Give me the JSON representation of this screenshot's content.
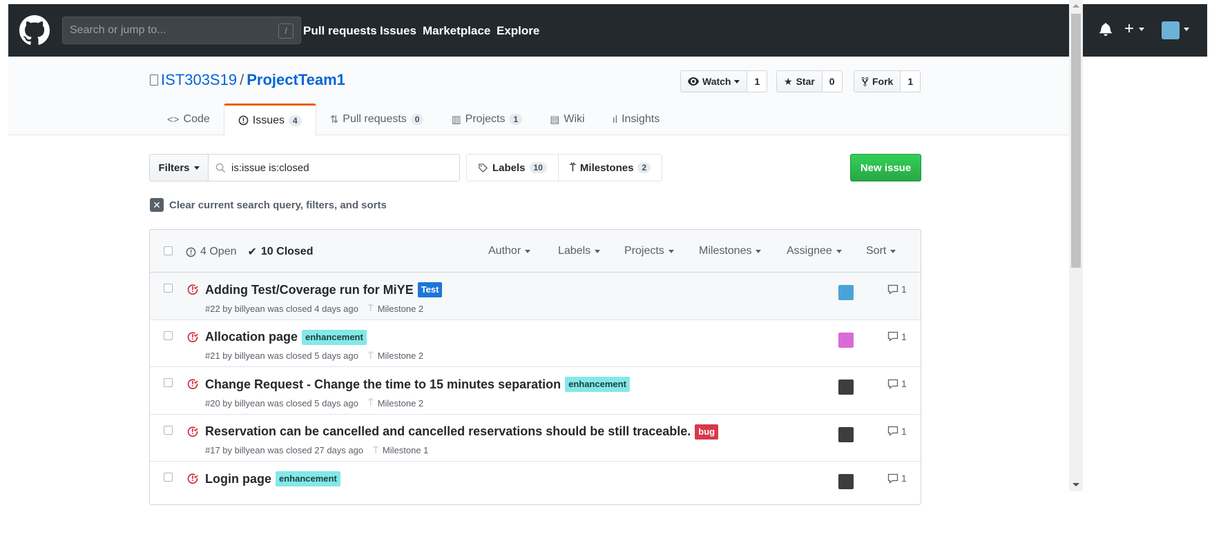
{
  "topnav": {
    "search_placeholder": "Search or jump to...",
    "slash": "/",
    "links": [
      "Pull requests",
      "Issues",
      "Marketplace",
      "Explore"
    ]
  },
  "repo": {
    "owner": "IST303S19",
    "separator": "/",
    "name": "ProjectTeam1",
    "watch_label": "Watch",
    "watch_count": "1",
    "star_label": "Star",
    "star_count": "0",
    "fork_label": "Fork",
    "fork_count": "1"
  },
  "tabs": [
    {
      "label": "Code",
      "icon": "code-icon",
      "count": ""
    },
    {
      "label": "Issues",
      "icon": "issue-opened-icon",
      "count": "4"
    },
    {
      "label": "Pull requests",
      "icon": "git-pull-request-icon",
      "count": "0"
    },
    {
      "label": "Projects",
      "icon": "project-icon",
      "count": "1"
    },
    {
      "label": "Wiki",
      "icon": "book-icon",
      "count": ""
    },
    {
      "label": "Insights",
      "icon": "graph-icon",
      "count": ""
    }
  ],
  "subnav": {
    "filters_label": "Filters",
    "search_value": "is:issue is:closed",
    "labels_label": "Labels",
    "labels_count": "10",
    "milestones_label": "Milestones",
    "milestones_count": "2",
    "new_issue_label": "New issue",
    "clear_label": "Clear current search query, filters, and sorts"
  },
  "issues_header": {
    "open_label": "4 Open",
    "closed_label": "10 Closed",
    "dropdowns": [
      "Author",
      "Labels",
      "Projects",
      "Milestones",
      "Assignee",
      "Sort"
    ]
  },
  "issues": [
    {
      "title": "Adding Test/Coverage run for MiYE",
      "label": "Test",
      "label_type": "test",
      "meta": "#22 by billyean was closed 4 days ago",
      "milestone": "Milestone 2",
      "comments": "1",
      "assignee_color": "#4aa3d8"
    },
    {
      "title": "Allocation page",
      "label": "enhancement",
      "label_type": "enhancement",
      "meta": "#21 by billyean was closed 5 days ago",
      "milestone": "Milestone 2",
      "comments": "1",
      "assignee_color": "#d86ad8"
    },
    {
      "title": "Change Request - Change the time to 15 minutes separation",
      "label": "enhancement",
      "label_type": "enhancement",
      "meta": "#20 by billyean was closed 5 days ago",
      "milestone": "Milestone 2",
      "comments": "1",
      "assignee_color": "#3d3d3d"
    },
    {
      "title": "Reservation can be cancelled and cancelled reservations should be still traceable.",
      "label": "bug",
      "label_type": "bug",
      "meta": "#17 by billyean was closed 27 days ago",
      "milestone": "Milestone 1",
      "comments": "1",
      "assignee_color": "#3d3d3d"
    },
    {
      "title": "Login page",
      "label": "enhancement",
      "label_type": "enhancement",
      "meta": "",
      "milestone": "",
      "comments": "1",
      "assignee_color": "#3d3d3d"
    }
  ],
  "colors": {
    "header_bg": "#24292e",
    "link_blue": "#0366d6",
    "closed_red": "#cb2431",
    "green_button": "#28a745",
    "tab_accent": "#e36209"
  }
}
